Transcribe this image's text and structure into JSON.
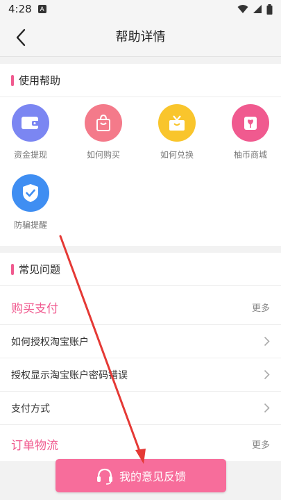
{
  "status_bar": {
    "time": "4:28",
    "notification_letter": "A"
  },
  "nav": {
    "title": "帮助详情"
  },
  "help_section": {
    "title": "使用帮助",
    "items": [
      {
        "label": "资金提现",
        "icon": "wallet-icon",
        "color": "#7b86f2"
      },
      {
        "label": "如何购买",
        "icon": "shopping-bag-icon",
        "color": "#f47a8a"
      },
      {
        "label": "如何兑换",
        "icon": "gift-icon",
        "color": "#f9c52c"
      },
      {
        "label": "柚币商城",
        "icon": "store-icon",
        "color": "#f05a8f"
      },
      {
        "label": "防骗提醒",
        "icon": "shield-check-icon",
        "color": "#3f8ef2"
      }
    ]
  },
  "faq_section": {
    "title": "常见问题",
    "categories": [
      {
        "title": "购买支付",
        "more": "更多",
        "questions": [
          "如何授权淘宝账户",
          "授权显示淘宝账户密码错误",
          "支付方式"
        ]
      },
      {
        "title": "订单物流",
        "more": "更多",
        "questions": []
      }
    ]
  },
  "feedback_button": {
    "label": "我的意见反馈"
  },
  "colors": {
    "accent": "#f05a8f",
    "button": "#f76d9b",
    "annotation_arrow": "#e53935"
  }
}
